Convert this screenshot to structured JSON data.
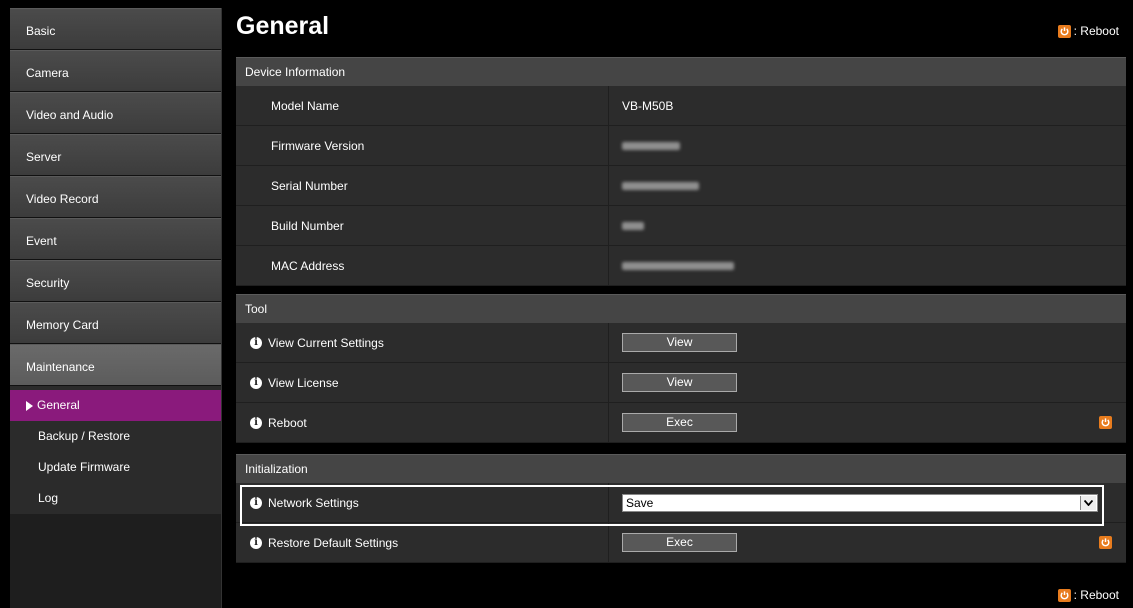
{
  "sidebar": {
    "items": [
      {
        "label": "Basic"
      },
      {
        "label": "Camera"
      },
      {
        "label": "Video and Audio"
      },
      {
        "label": "Server"
      },
      {
        "label": "Video Record"
      },
      {
        "label": "Event"
      },
      {
        "label": "Security"
      },
      {
        "label": "Memory Card"
      },
      {
        "label": "Maintenance"
      }
    ],
    "sub_items": [
      {
        "label": "General"
      },
      {
        "label": "Backup / Restore"
      },
      {
        "label": "Update Firmware"
      },
      {
        "label": "Log"
      }
    ]
  },
  "header": {
    "title": "General",
    "reboot_label": ": Reboot"
  },
  "device_info": {
    "heading": "Device Information",
    "rows": [
      {
        "label": "Model Name",
        "value": "VB-M50B"
      },
      {
        "label": "Firmware Version",
        "value": ""
      },
      {
        "label": "Serial Number",
        "value": ""
      },
      {
        "label": "Build Number",
        "value": ""
      },
      {
        "label": "MAC Address",
        "value": ""
      }
    ]
  },
  "tool": {
    "heading": "Tool",
    "rows": [
      {
        "label": "View Current Settings",
        "button": "View"
      },
      {
        "label": "View License",
        "button": "View"
      },
      {
        "label": "Reboot",
        "button": "Exec"
      }
    ]
  },
  "initialization": {
    "heading": "Initialization",
    "rows": [
      {
        "label": "Network Settings",
        "select_value": "Save"
      },
      {
        "label": "Restore Default Settings",
        "button": "Exec"
      }
    ]
  },
  "footer": {
    "reboot_label": ": Reboot"
  },
  "colors": {
    "accent_active": "#8a1a7c",
    "power_icon": "#e87c1e"
  }
}
